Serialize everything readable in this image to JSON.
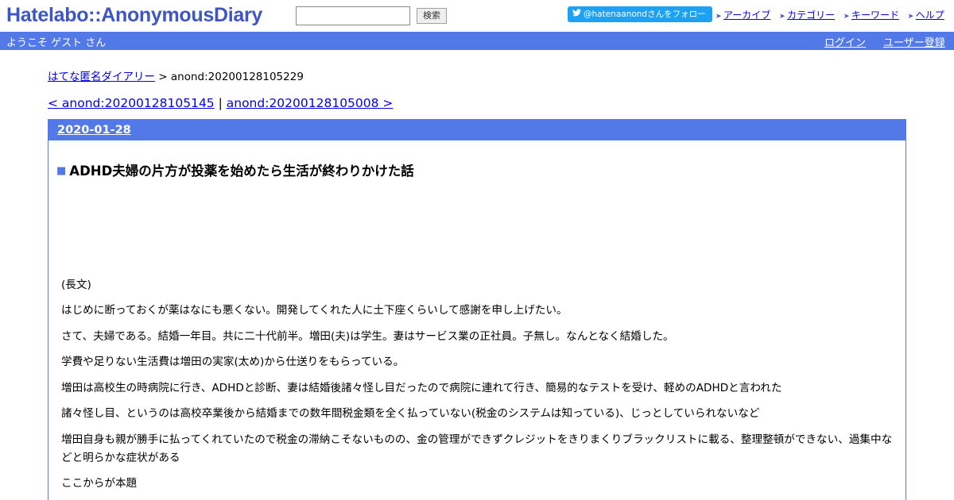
{
  "header": {
    "logo": "Hatelabo::AnonymousDiary",
    "search": {
      "value": "",
      "button_label": "検索"
    },
    "follow_button": "@hatenaanondさんをフォロー",
    "nav": [
      "アーカイブ",
      "カテゴリー",
      "キーワード",
      "ヘルプ"
    ]
  },
  "bar": {
    "welcome": "ようこそ ゲスト さん",
    "login": "ログイン",
    "register": "ユーザー登録"
  },
  "breadcrumb": {
    "home": "はてな匿名ダイアリー",
    "separator": " > ",
    "current": "anond:20200128105229"
  },
  "pager": {
    "prev": "< anond:20200128105145",
    "separator": " | ",
    "next": "anond:20200128105008 >"
  },
  "entry": {
    "date": "2020-01-28",
    "bullet": "■",
    "title": "ADHD夫婦の片方が投薬を始めたら生活が終わりかけた話",
    "paragraphs": [
      "(長文)",
      "はじめに断っておくが薬はなにも悪くない。開発してくれた人に土下座くらいして感謝を申し上げたい。",
      "さて、夫婦である。結婚一年目。共に二十代前半。増田(夫)は学生。妻はサービス業の正社員。子無し。なんとなく結婚した。",
      "学費や足りない生活費は増田の実家(太め)から仕送りをもらっている。",
      "増田は高校生の時病院に行き、ADHDと診断、妻は結婚後諸々怪し目だったので病院に連れて行き、簡易的なテストを受け、軽めのADHDと言われた",
      "諸々怪し目、というのは高校卒業後から結婚までの数年間税金類を全く払っていない(税金のシステムは知っている)、じっとしていられないなど",
      "増田自身も親が勝手に払ってくれていたので税金の滞納こそないものの、金の管理ができずクレジットをきりまくりブラックリストに載る、整理整頓ができない、過集中などと明らかな症状がある",
      "ここからが本題"
    ]
  }
}
